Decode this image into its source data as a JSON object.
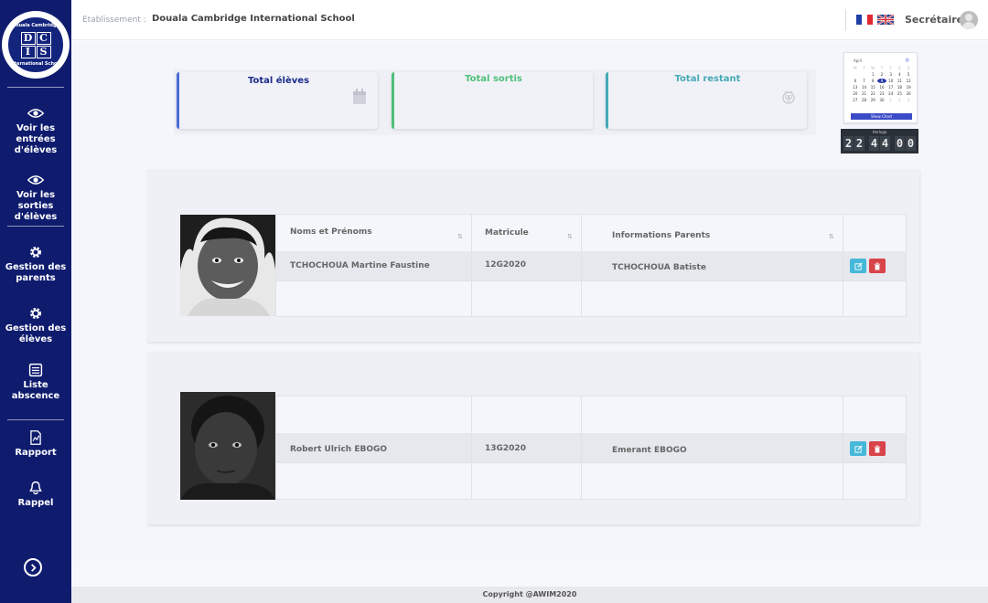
{
  "school": {
    "logo_letters": [
      "D",
      "C",
      "I",
      "S"
    ],
    "logo_ring_top": "Douala Cambridge",
    "logo_ring_bottom": "International School",
    "label": "Etablissement :",
    "name": "Douala Cambridge International School"
  },
  "sidebar": {
    "items": [
      {
        "label": "Voir les entrées d'élèves",
        "icon": "eye-icon"
      },
      {
        "label": "Voir les sorties d'élèves",
        "icon": "eye-icon"
      },
      {
        "label": "Gestion des parents",
        "icon": "gear-icon"
      },
      {
        "label": "Gestion des élèves",
        "icon": "gear-icon"
      },
      {
        "label": "Liste abscence",
        "icon": "checklist-icon"
      },
      {
        "label": "Rapport",
        "icon": "report-icon"
      },
      {
        "label": "Rappel",
        "icon": "bell-icon"
      }
    ],
    "collapse_icon": "chevron-right-circle-icon"
  },
  "header": {
    "user_role": "Secrétaire",
    "languages": [
      "fr",
      "en"
    ]
  },
  "stats": [
    {
      "title": "Total élèves",
      "color": "#1c2c8a",
      "accent": "#4a6bd6",
      "icon": "calendar-icon"
    },
    {
      "title": "Total sortis",
      "color": "#4fbf7a",
      "accent": "#4fbf7a",
      "icon": ""
    },
    {
      "title": "Total restant",
      "color": "#45aab8",
      "accent": "#45aab8",
      "icon": "raspberry-icon"
    }
  ],
  "calendar": {
    "month": "April",
    "weekdays": [
      "M",
      "T",
      "W",
      "T",
      "F",
      "S",
      "S"
    ],
    "days": [
      "",
      "",
      "1",
      "2",
      "3",
      "4",
      "5",
      "6",
      "7",
      "8",
      "9",
      "10",
      "11",
      "12",
      "13",
      "14",
      "15",
      "16",
      "17",
      "18",
      "19",
      "20",
      "21",
      "22",
      "23",
      "24",
      "25",
      "26",
      "27",
      "28",
      "29",
      "30",
      "1",
      "2",
      "3"
    ],
    "today": "9",
    "button_label": "Show Chart"
  },
  "clock": {
    "label": "Horloge",
    "digits": [
      "2",
      "2",
      "4",
      "4",
      "0",
      "0"
    ]
  },
  "table": {
    "headers": [
      "Noms et Prénoms",
      "Matricule",
      "Informations Parents"
    ],
    "sort_icon": "⇅"
  },
  "students": [
    {
      "name": "TCHOCHOUA Martine Faustine",
      "matricule": "12G2020",
      "parent": "TCHOCHOUA Batiste"
    },
    {
      "name": "Robert Ulrich EBOGO",
      "matricule": "13G2020",
      "parent": "Emerant EBOGO"
    }
  ],
  "actions": {
    "edit_icon": "edit-icon",
    "delete_icon": "trash-icon"
  },
  "footer": {
    "text": "Copyright @AWIM2020"
  }
}
